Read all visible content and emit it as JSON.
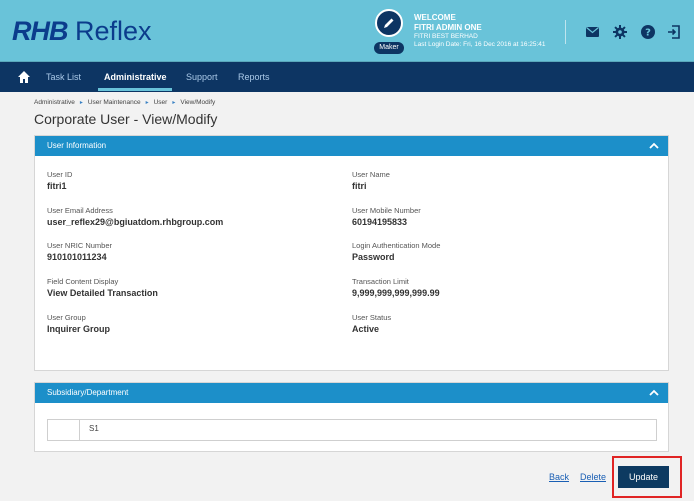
{
  "header": {
    "logo_brand": "RHB",
    "logo_product": "Reflex",
    "role_badge": "Maker",
    "welcome": "WELCOME",
    "user_name": "FITRI ADMIN ONE",
    "company": "FITRI BEST BERHAD",
    "last_login": "Last Login Date: Fri, 16 Dec 2016 at 16:25:41",
    "icons": [
      "mail-icon",
      "gear-icon",
      "help-icon",
      "logout-icon"
    ]
  },
  "nav": {
    "items": [
      {
        "label": "Task List",
        "active": false
      },
      {
        "label": "Administrative",
        "active": true
      },
      {
        "label": "Support",
        "active": false
      },
      {
        "label": "Reports",
        "active": false
      }
    ]
  },
  "breadcrumb": [
    "Administrative",
    "User Maintenance",
    "User",
    "View/Modify"
  ],
  "page_title": "Corporate User - View/Modify",
  "user_info": {
    "title": "User Information",
    "fields": [
      {
        "label": "User ID",
        "value": "fitri1"
      },
      {
        "label": "User Name",
        "value": "fitri"
      },
      {
        "label": "User Email Address",
        "value": "user_reflex29@bgiuatdom.rhbgroup.com"
      },
      {
        "label": "User Mobile Number",
        "value": "60194195833"
      },
      {
        "label": "User NRIC Number",
        "value": "910101011234"
      },
      {
        "label": "Login Authentication Mode",
        "value": "Password"
      },
      {
        "label": "Field Content Display",
        "value": "View Detailed Transaction"
      },
      {
        "label": "Transaction Limit",
        "value": "9,999,999,999,999.99"
      },
      {
        "label": "User Group",
        "value": "Inquirer Group"
      },
      {
        "label": "User Status",
        "value": "Active"
      }
    ]
  },
  "subsidiary": {
    "title": "Subsidiary/Department",
    "rows": [
      "S1"
    ]
  },
  "actions": {
    "back": "Back",
    "delete": "Delete",
    "update": "Update"
  },
  "colors": {
    "header_bg": "#69c3d9",
    "nav_bg": "#0d3563",
    "panel_head": "#1c8fc9",
    "highlight": "#e02424"
  }
}
